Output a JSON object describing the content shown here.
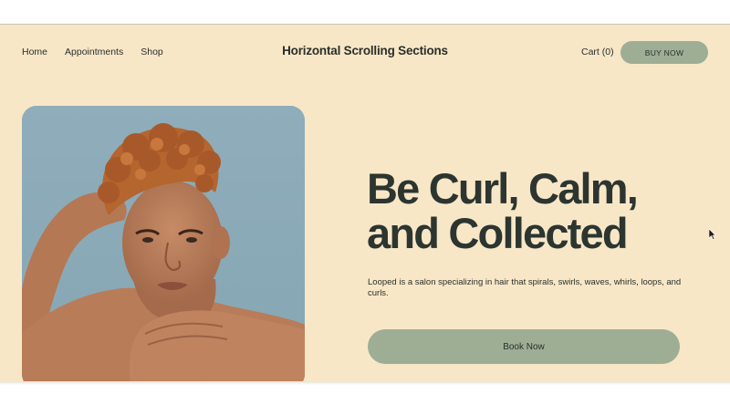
{
  "nav": {
    "items": [
      {
        "label": "Home"
      },
      {
        "label": "Appointments"
      },
      {
        "label": "Shop"
      }
    ]
  },
  "header": {
    "title": "Horizontal Scrolling Sections",
    "cart_label": "Cart (0)",
    "buy_label": "BUY NOW"
  },
  "hero": {
    "headline_line1": "Be Curl, Calm,",
    "headline_line2": "and Collected",
    "description": "Looped is a salon specializing in hair that spirals, swirls, waves, whirls, loops, and curls.",
    "cta_label": "Book Now",
    "image_icon": "portrait-photo"
  },
  "colors": {
    "page_bg": "#f8e7c7",
    "accent_button": "#9eae95",
    "text_dark": "#2c3530",
    "photo_sky": "#8ba9b6"
  }
}
